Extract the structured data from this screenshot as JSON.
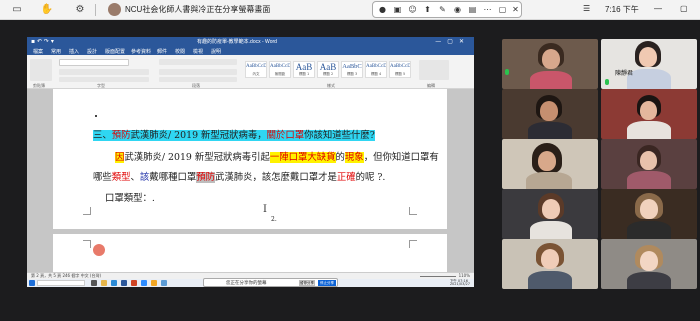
{
  "topbar": {
    "title": "NCU社会化師人書與冷正在分享螢幕畫面",
    "time": "7:16 下午",
    "icons": [
      "chat-icon",
      "reaction-icon",
      "settings-icon"
    ]
  },
  "word": {
    "window_title": "有趣的防疫單-教學範本.docx - Word",
    "tabs": [
      "檔案",
      "常用",
      "插入",
      "設計",
      "版面配置",
      "參考資料",
      "郵件",
      "校閱",
      "檢視",
      "說明"
    ],
    "styles": [
      {
        "sample": "AaBbCcD",
        "name": "內文"
      },
      {
        "sample": "AaBbCcD",
        "name": "無間距"
      },
      {
        "sample": "AaB",
        "name": "標題 1"
      },
      {
        "sample": "AaB",
        "name": "標題 2"
      },
      {
        "sample": "AaBbC",
        "name": "標題 3"
      },
      {
        "sample": "AaBbCcD",
        "name": "標題 4"
      },
      {
        "sample": "AaBbCcD",
        "name": "標題 5"
      }
    ],
    "ribbon_labels": {
      "clipboard": "剪貼簿",
      "font": "字型",
      "paragraph": "段落",
      "styles": "樣式",
      "editing": "編輯"
    },
    "doc": {
      "l1_a": "三、",
      "l1_b": "預防",
      "l1_c": "武漢肺炎",
      "l1_d": "/ 2019 新型冠狀病毒，",
      "l1_e": "關於口罩",
      "l1_f": "你該知道些什麼?",
      "l2_a": "因",
      "l2_b": "武漢肺炎/ 2019 新型冠狀病毒引起",
      "l2_c": "一陣",
      "l2_d": "口罩大缺貨",
      "l2_e": "的",
      "l2_f": "現象",
      "l2_g": "，但你知道口罩有",
      "l3_a": "哪些",
      "l3_b": "類型",
      "l3_c": "、",
      "l3_d": "該",
      "l3_e": "戴哪種口罩",
      "l3_f": "預防",
      "l3_g": "武漢肺炎，該怎麼戴口罩才是",
      "l3_h": "正確",
      "l3_i": "的呢 ?.",
      "l4": "口罩類型：.",
      "page_num": "2."
    },
    "status_left": "第 2 頁，共 5 頁    246 個字    中文 (台灣)",
    "zoom": "110%",
    "share_banner": "您正在分享你的螢幕",
    "share_btn1": "暫停分享",
    "share_btn2": "停止分享",
    "tray_time": "下午 07:16",
    "tray_date": "2021/03/27"
  },
  "participants": [
    {
      "name": ""
    },
    {
      "name": "陳靜君"
    },
    {
      "name": ""
    },
    {
      "name": ""
    },
    {
      "name": ""
    },
    {
      "name": ""
    },
    {
      "name": ""
    },
    {
      "name": ""
    },
    {
      "name": ""
    },
    {
      "name": ""
    }
  ],
  "colors": {
    "word_blue": "#2b579a",
    "highlight_cyan": "#2fd6f2",
    "highlight_yellow": "#fff200",
    "mic_active": "#2ac24e"
  }
}
